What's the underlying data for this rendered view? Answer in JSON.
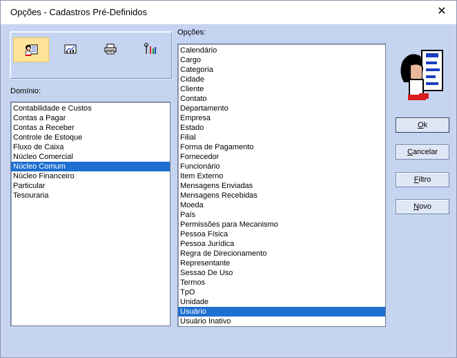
{
  "window": {
    "title": "Opções - Cadastros Pré-Definidos",
    "close_glyph": "✕"
  },
  "toolbar": {
    "icons": [
      "person-card-icon",
      "chart-icon",
      "printer-icon",
      "tools-icon"
    ]
  },
  "dominio": {
    "label": "Domínio:",
    "items": [
      "Contabilidade e Custos",
      "Contas a Pagar",
      "Contas a Receber",
      "Controle de Estoque",
      "Fluxo de Caixa",
      "Núcleo Comercial",
      "Núcleo Comum",
      "Núcleo Financeiro",
      "Particular",
      "Tesouraria"
    ],
    "selected": "Núcleo Comum"
  },
  "opcoes": {
    "label": "Opções:",
    "items": [
      "Calendário",
      "Cargo",
      "Categoria",
      "Cidade",
      "Cliente",
      "Contato",
      "Departamento",
      "Empresa",
      "Estado",
      "Filial",
      "Forma de Pagamento",
      "Fornecedor",
      "Funcionário",
      "Item Externo",
      "Mensagens Enviadas",
      "Mensagens Recebidas",
      "Moeda",
      "País",
      "Permissões para Mecanismo",
      "Pessoa Física",
      "Pessoa Jurídica",
      "Regra de Direcionamento",
      "Representante",
      "Sessao De Uso",
      "Termos",
      "TpO",
      "Unidade",
      "Usuário",
      "Usuário Inativo"
    ],
    "selected": "Usuário"
  },
  "buttons": {
    "ok": {
      "hot": "O",
      "rest": "k"
    },
    "cancelar": {
      "hot": "C",
      "rest": "ancelar"
    },
    "filtro": {
      "hot": "F",
      "rest": "iltro"
    },
    "novo": {
      "hot": "N",
      "rest": "ovo"
    }
  },
  "colors": {
    "selection": "#1e6fd0",
    "window_bg": "#c5d4f0",
    "toolbar_selected": "#ffe49a"
  }
}
